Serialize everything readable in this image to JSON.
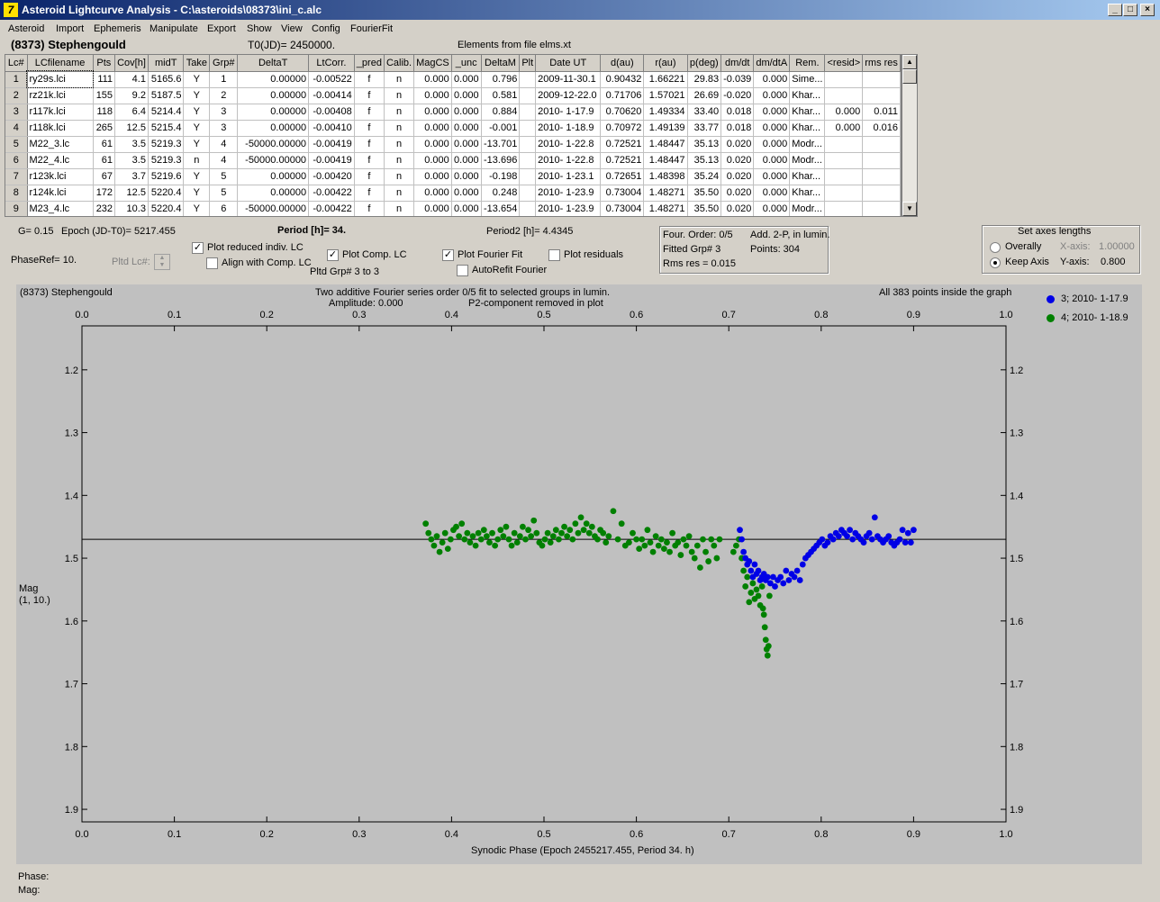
{
  "window": {
    "title": "Asteroid Lightcurve Analysis - C:\\asteroids\\08373\\ini_c.alc",
    "icon": "7",
    "min": "_",
    "max": "□",
    "close": "×"
  },
  "menu": [
    "Asteroid",
    "Import",
    "Ephemeris",
    "Manipulate",
    "Export",
    "Show",
    "View",
    "Config",
    "FourierFit"
  ],
  "header": {
    "object": "(8373) Stephengould",
    "t0": "T0(JD)= 2450000.",
    "elements": "Elements from file elms.xt"
  },
  "table": {
    "columns": [
      "Lc#",
      "LCfilename",
      "Pts",
      "Cov[h]",
      "midT",
      "Take",
      "Grp#",
      "DeltaT",
      "LtCorr.",
      "_pred",
      "Calib.",
      "MagCS",
      "_unc",
      "DeltaM",
      "Plt",
      "Date UT",
      "d(au)",
      "r(au)",
      "p(deg)",
      "dm/dt",
      "dm/dtA",
      "Rem.",
      "<resid>",
      "rms res"
    ],
    "rows": [
      [
        "1",
        "ry29s.lci",
        "111",
        "4.1",
        "5165.6",
        "Y",
        "1",
        "0.00000",
        "-0.00522",
        "f",
        "n",
        "0.000",
        "0.000",
        "0.796",
        "",
        "2009-11-30.1",
        "0.90432",
        "1.66221",
        "29.83",
        "-0.039",
        "0.000",
        "Sime...",
        "",
        ""
      ],
      [
        "2",
        "rz21k.lci",
        "155",
        "9.2",
        "5187.5",
        "Y",
        "2",
        "0.00000",
        "-0.00414",
        "f",
        "n",
        "0.000",
        "0.000",
        "0.581",
        "",
        "2009-12-22.0",
        "0.71706",
        "1.57021",
        "26.69",
        "-0.020",
        "0.000",
        "Khar...",
        "",
        ""
      ],
      [
        "3",
        "r117k.lci",
        "118",
        "6.4",
        "5214.4",
        "Y",
        "3",
        "0.00000",
        "-0.00408",
        "f",
        "n",
        "0.000",
        "0.000",
        "0.884",
        "",
        "2010- 1-17.9",
        "0.70620",
        "1.49334",
        "33.40",
        "0.018",
        "0.000",
        "Khar...",
        "0.000",
        "0.011"
      ],
      [
        "4",
        "r118k.lci",
        "265",
        "12.5",
        "5215.4",
        "Y",
        "3",
        "0.00000",
        "-0.00410",
        "f",
        "n",
        "0.000",
        "0.000",
        "-0.001",
        "",
        "2010- 1-18.9",
        "0.70972",
        "1.49139",
        "33.77",
        "0.018",
        "0.000",
        "Khar...",
        "0.000",
        "0.016"
      ],
      [
        "5",
        "M22_3.lc",
        "61",
        "3.5",
        "5219.3",
        "Y",
        "4",
        "-50000.00000",
        "-0.00419",
        "f",
        "n",
        "0.000",
        "0.000",
        "-13.701",
        "",
        "2010- 1-22.8",
        "0.72521",
        "1.48447",
        "35.13",
        "0.020",
        "0.000",
        "Modr...",
        "",
        ""
      ],
      [
        "6",
        "M22_4.lc",
        "61",
        "3.5",
        "5219.3",
        "n",
        "4",
        "-50000.00000",
        "-0.00419",
        "f",
        "n",
        "0.000",
        "0.000",
        "-13.696",
        "",
        "2010- 1-22.8",
        "0.72521",
        "1.48447",
        "35.13",
        "0.020",
        "0.000",
        "Modr...",
        "",
        ""
      ],
      [
        "7",
        "r123k.lci",
        "67",
        "3.7",
        "5219.6",
        "Y",
        "5",
        "0.00000",
        "-0.00420",
        "f",
        "n",
        "0.000",
        "0.000",
        "-0.198",
        "",
        "2010- 1-23.1",
        "0.72651",
        "1.48398",
        "35.24",
        "0.020",
        "0.000",
        "Khar...",
        "",
        ""
      ],
      [
        "8",
        "r124k.lci",
        "172",
        "12.5",
        "5220.4",
        "Y",
        "5",
        "0.00000",
        "-0.00422",
        "f",
        "n",
        "0.000",
        "0.000",
        "0.248",
        "",
        "2010- 1-23.9",
        "0.73004",
        "1.48271",
        "35.50",
        "0.020",
        "0.000",
        "Khar...",
        "",
        ""
      ],
      [
        "9",
        "M23_4.lc",
        "232",
        "10.3",
        "5220.4",
        "Y",
        "6",
        "-50000.00000",
        "-0.00422",
        "f",
        "n",
        "0.000",
        "0.000",
        "-13.654",
        "",
        "2010- 1-23.9",
        "0.73004",
        "1.48271",
        "35.50",
        "0.020",
        "0.000",
        "Modr...",
        "",
        ""
      ]
    ]
  },
  "controls": {
    "g": "G= 0.15",
    "epoch": "Epoch (JD-T0)= 5217.455",
    "period": "Period [h]= 34.",
    "period2": "Period2 [h]= 4.4345",
    "phaseref": "PhaseRef= 10.",
    "pltd_lc": "Pltd Lc#:",
    "plot_reduced": "Plot reduced indiv. LC",
    "align_comp": "Align with Comp. LC",
    "plot_comp": "Plot Comp. LC",
    "pltd_grp": "Pltd Grp#  3   to   3",
    "plot_fourier": "Plot Fourier Fit",
    "autorefit": "AutoRefit Fourier",
    "plot_residuals": "Plot residuals",
    "checks": {
      "plot_reduced": true,
      "align_comp": false,
      "plot_comp": true,
      "plot_fourier": true,
      "autorefit": false,
      "plot_residuals": false
    },
    "check_mark": "✓",
    "fourier_info": {
      "order": "Four. Order:  0/5",
      "add": "Add. 2-P, in lumin.",
      "fitted": "Fitted Grp# 3",
      "points": "Points: 304",
      "rms": "Rms res     = 0.015"
    },
    "axes": {
      "title": "Set axes lengths",
      "overally": "Overally",
      "keep": "Keep Axis",
      "xaxis": "X-axis:",
      "xval": "1.00000",
      "yaxis": "Y-axis:",
      "yval": "0.800",
      "selected": "keep"
    }
  },
  "plot": {
    "object": "(8373) Stephengould",
    "line1": "Two additive Fourier series order 0/5 fit to selected groups in lumin.",
    "line2a": "Amplitude: 0.000",
    "line2b": "P2-component removed in plot",
    "inside": "All 383 points inside the graph",
    "ylabel1": "Mag",
    "ylabel2": "(1, 10.)",
    "xlabel": "Synodic Phase (Epoch 2455217.455, Period 34. h)",
    "legend": [
      {
        "label": "3; 2010- 1-17.9",
        "color": "#0000e6"
      },
      {
        "label": "4; 2010- 1-18.9",
        "color": "#008000"
      }
    ]
  },
  "status": {
    "phase": "Phase:",
    "mag": "Mag:"
  },
  "chart_data": {
    "type": "scatter",
    "title": "Two additive Fourier series order 0/5 fit to selected groups in lumin.",
    "xlabel": "Synodic Phase (Epoch 2455217.455, Period 34. h)",
    "ylabel": "Mag",
    "xlim": [
      0.0,
      1.0
    ],
    "ylim": [
      1.92,
      1.13
    ],
    "y_inverted": true,
    "xticks": [
      "0.0",
      "0.1",
      "0.2",
      "0.3",
      "0.4",
      "0.5",
      "0.6",
      "0.7",
      "0.8",
      "0.9",
      "1.0"
    ],
    "yticks": [
      "1.2",
      "1.3",
      "1.4",
      "1.5",
      "1.6",
      "1.7",
      "1.8",
      "1.9"
    ],
    "fit_line": 1.47,
    "series": [
      {
        "name": "3; 2010- 1-17.9",
        "color": "#0000e6",
        "points": [
          [
            0.712,
            1.455
          ],
          [
            0.714,
            1.47
          ],
          [
            0.716,
            1.49
          ],
          [
            0.718,
            1.5
          ],
          [
            0.72,
            1.51
          ],
          [
            0.722,
            1.505
          ],
          [
            0.724,
            1.52
          ],
          [
            0.726,
            1.53
          ],
          [
            0.728,
            1.51
          ],
          [
            0.73,
            1.525
          ],
          [
            0.732,
            1.52
          ],
          [
            0.734,
            1.535
          ],
          [
            0.736,
            1.53
          ],
          [
            0.738,
            1.525
          ],
          [
            0.74,
            1.535
          ],
          [
            0.742,
            1.53
          ],
          [
            0.745,
            1.54
          ],
          [
            0.748,
            1.53
          ],
          [
            0.75,
            1.545
          ],
          [
            0.753,
            1.535
          ],
          [
            0.756,
            1.53
          ],
          [
            0.759,
            1.54
          ],
          [
            0.762,
            1.52
          ],
          [
            0.765,
            1.535
          ],
          [
            0.768,
            1.525
          ],
          [
            0.771,
            1.53
          ],
          [
            0.774,
            1.52
          ],
          [
            0.777,
            1.535
          ],
          [
            0.78,
            1.51
          ],
          [
            0.783,
            1.5
          ],
          [
            0.786,
            1.495
          ],
          [
            0.789,
            1.49
          ],
          [
            0.792,
            1.485
          ],
          [
            0.795,
            1.48
          ],
          [
            0.798,
            1.475
          ],
          [
            0.801,
            1.47
          ],
          [
            0.804,
            1.48
          ],
          [
            0.807,
            1.475
          ],
          [
            0.81,
            1.465
          ],
          [
            0.813,
            1.47
          ],
          [
            0.816,
            1.46
          ],
          [
            0.819,
            1.465
          ],
          [
            0.822,
            1.455
          ],
          [
            0.825,
            1.46
          ],
          [
            0.828,
            1.465
          ],
          [
            0.831,
            1.455
          ],
          [
            0.834,
            1.47
          ],
          [
            0.837,
            1.46
          ],
          [
            0.84,
            1.465
          ],
          [
            0.843,
            1.47
          ],
          [
            0.846,
            1.475
          ],
          [
            0.849,
            1.465
          ],
          [
            0.852,
            1.46
          ],
          [
            0.855,
            1.47
          ],
          [
            0.858,
            1.435
          ],
          [
            0.861,
            1.465
          ],
          [
            0.864,
            1.47
          ],
          [
            0.867,
            1.475
          ],
          [
            0.87,
            1.47
          ],
          [
            0.873,
            1.465
          ],
          [
            0.876,
            1.475
          ],
          [
            0.879,
            1.48
          ],
          [
            0.882,
            1.475
          ],
          [
            0.885,
            1.47
          ],
          [
            0.888,
            1.455
          ],
          [
            0.891,
            1.475
          ],
          [
            0.894,
            1.46
          ],
          [
            0.897,
            1.475
          ],
          [
            0.9,
            1.455
          ]
        ]
      },
      {
        "name": "4; 2010- 1-18.9",
        "color": "#008000",
        "points": [
          [
            0.372,
            1.445
          ],
          [
            0.375,
            1.46
          ],
          [
            0.378,
            1.47
          ],
          [
            0.381,
            1.48
          ],
          [
            0.384,
            1.465
          ],
          [
            0.387,
            1.49
          ],
          [
            0.39,
            1.475
          ],
          [
            0.393,
            1.46
          ],
          [
            0.396,
            1.485
          ],
          [
            0.399,
            1.47
          ],
          [
            0.402,
            1.455
          ],
          [
            0.405,
            1.45
          ],
          [
            0.408,
            1.465
          ],
          [
            0.411,
            1.445
          ],
          [
            0.414,
            1.47
          ],
          [
            0.417,
            1.46
          ],
          [
            0.42,
            1.475
          ],
          [
            0.423,
            1.465
          ],
          [
            0.426,
            1.48
          ],
          [
            0.429,
            1.46
          ],
          [
            0.432,
            1.47
          ],
          [
            0.435,
            1.455
          ],
          [
            0.438,
            1.465
          ],
          [
            0.441,
            1.475
          ],
          [
            0.444,
            1.46
          ],
          [
            0.447,
            1.48
          ],
          [
            0.45,
            1.47
          ],
          [
            0.453,
            1.455
          ],
          [
            0.456,
            1.465
          ],
          [
            0.459,
            1.45
          ],
          [
            0.462,
            1.47
          ],
          [
            0.465,
            1.48
          ],
          [
            0.468,
            1.46
          ],
          [
            0.471,
            1.475
          ],
          [
            0.474,
            1.465
          ],
          [
            0.477,
            1.45
          ],
          [
            0.48,
            1.47
          ],
          [
            0.483,
            1.455
          ],
          [
            0.486,
            1.465
          ],
          [
            0.489,
            1.44
          ],
          [
            0.492,
            1.46
          ],
          [
            0.495,
            1.475
          ],
          [
            0.498,
            1.48
          ],
          [
            0.501,
            1.47
          ],
          [
            0.504,
            1.46
          ],
          [
            0.507,
            1.475
          ],
          [
            0.51,
            1.465
          ],
          [
            0.513,
            1.455
          ],
          [
            0.516,
            1.47
          ],
          [
            0.519,
            1.46
          ],
          [
            0.522,
            1.45
          ],
          [
            0.525,
            1.465
          ],
          [
            0.528,
            1.455
          ],
          [
            0.531,
            1.47
          ],
          [
            0.534,
            1.445
          ],
          [
            0.537,
            1.46
          ],
          [
            0.54,
            1.435
          ],
          [
            0.543,
            1.455
          ],
          [
            0.546,
            1.445
          ],
          [
            0.549,
            1.46
          ],
          [
            0.552,
            1.45
          ],
          [
            0.555,
            1.465
          ],
          [
            0.558,
            1.47
          ],
          [
            0.561,
            1.455
          ],
          [
            0.564,
            1.46
          ],
          [
            0.567,
            1.475
          ],
          [
            0.57,
            1.465
          ],
          [
            0.575,
            1.425
          ],
          [
            0.58,
            1.47
          ],
          [
            0.584,
            1.445
          ],
          [
            0.588,
            1.48
          ],
          [
            0.592,
            1.475
          ],
          [
            0.596,
            1.46
          ],
          [
            0.6,
            1.47
          ],
          [
            0.603,
            1.485
          ],
          [
            0.606,
            1.47
          ],
          [
            0.609,
            1.48
          ],
          [
            0.612,
            1.455
          ],
          [
            0.615,
            1.475
          ],
          [
            0.618,
            1.49
          ],
          [
            0.621,
            1.465
          ],
          [
            0.624,
            1.48
          ],
          [
            0.627,
            1.47
          ],
          [
            0.63,
            1.485
          ],
          [
            0.633,
            1.475
          ],
          [
            0.636,
            1.49
          ],
          [
            0.639,
            1.46
          ],
          [
            0.642,
            1.48
          ],
          [
            0.645,
            1.475
          ],
          [
            0.648,
            1.495
          ],
          [
            0.651,
            1.47
          ],
          [
            0.654,
            1.48
          ],
          [
            0.657,
            1.465
          ],
          [
            0.66,
            1.49
          ],
          [
            0.663,
            1.5
          ],
          [
            0.666,
            1.48
          ],
          [
            0.669,
            1.515
          ],
          [
            0.672,
            1.47
          ],
          [
            0.675,
            1.49
          ],
          [
            0.678,
            1.505
          ],
          [
            0.681,
            1.47
          ],
          [
            0.684,
            1.48
          ],
          [
            0.687,
            1.5
          ],
          [
            0.69,
            1.47
          ],
          [
            0.705,
            1.49
          ],
          [
            0.708,
            1.48
          ],
          [
            0.711,
            1.47
          ],
          [
            0.714,
            1.5
          ],
          [
            0.716,
            1.52
          ],
          [
            0.718,
            1.545
          ],
          [
            0.72,
            1.53
          ],
          [
            0.722,
            1.57
          ],
          [
            0.724,
            1.555
          ],
          [
            0.726,
            1.54
          ],
          [
            0.728,
            1.565
          ],
          [
            0.73,
            1.55
          ],
          [
            0.732,
            1.56
          ],
          [
            0.734,
            1.575
          ],
          [
            0.736,
            1.545
          ],
          [
            0.737,
            1.58
          ],
          [
            0.738,
            1.59
          ],
          [
            0.739,
            1.61
          ],
          [
            0.74,
            1.63
          ],
          [
            0.741,
            1.645
          ],
          [
            0.742,
            1.655
          ],
          [
            0.743,
            1.64
          ],
          [
            0.744,
            1.56
          ]
        ]
      }
    ]
  }
}
